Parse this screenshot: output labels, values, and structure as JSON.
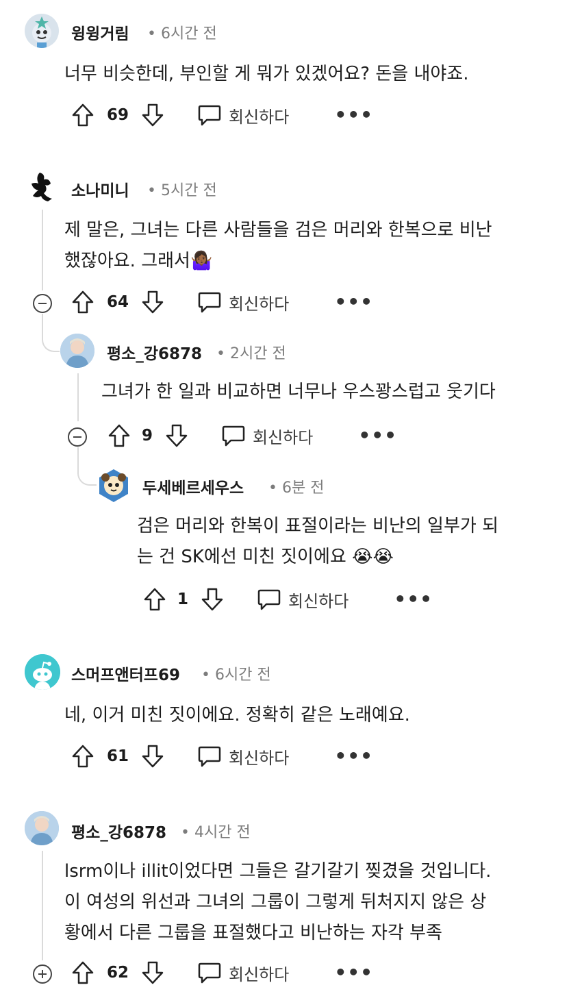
{
  "comments": [
    {
      "username": "윙윙거림",
      "time": "• 6시간 전",
      "body": [
        "너무 비슷한데, 부인할 게 뭐가 있겠어요? 돈을 내야죠."
      ],
      "votes": "69",
      "reply_label": "회신하다",
      "more_label": "•••"
    },
    {
      "username": "소나미니",
      "time": "• 5시간 전",
      "body": [
        "제 말은, 그녀는 다른 사람들을 검은 머리와 한복으로 비난",
        "했잖아요. 그래서🤷🏾‍♀️"
      ],
      "votes": "64",
      "reply_label": "회신하다",
      "more_label": "•••"
    },
    {
      "username": "평소_강6878",
      "time": "• 2시간 전",
      "body": [
        "그녀가 한 일과 비교하면 너무나 우스꽝스럽고 웃기다"
      ],
      "votes": "9",
      "reply_label": "회신하다",
      "more_label": "•••"
    },
    {
      "username": "두세베르세우스",
      "time": "• 6분 전",
      "body": [
        "검은 머리와 한복이 표절이라는 비난의 일부가 되",
        "는 건 SK에선 미친 짓이에요 😭😭"
      ],
      "votes": "1",
      "reply_label": "회신하다",
      "more_label": "•••"
    },
    {
      "username": "스머프앤터프69",
      "time": "• 6시간 전",
      "body": [
        "네, 이거 미친 짓이에요. 정확히 같은 노래예요."
      ],
      "votes": "61",
      "reply_label": "회신하다",
      "more_label": "•••"
    },
    {
      "username": "평소_강6878",
      "time": "• 4시간 전",
      "body": [
        "lsrm이나 illit이었다면 그들은 갈기갈기 찢겼을 것입니다.",
        "이 여성의 위선과 그녀의 그룹이 그렇게 뒤처지지 않은 상",
        "황에서 다른 그룹을 표절했다고 비난하는 자각 부족"
      ],
      "votes": "62",
      "reply_label": "회신하다",
      "more_label": "•••"
    }
  ]
}
